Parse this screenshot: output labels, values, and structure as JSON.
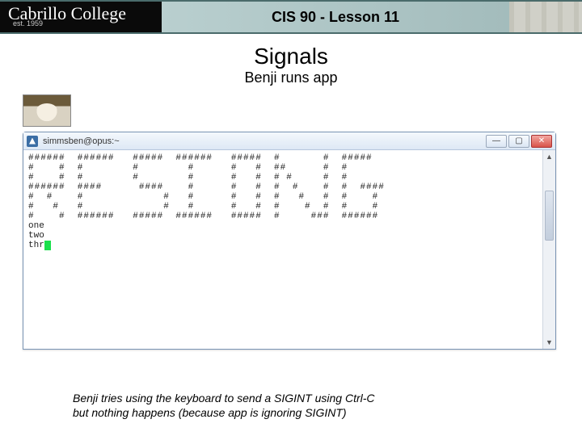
{
  "header": {
    "logo_name": "Cabrillo College",
    "logo_est": "est. 1959",
    "course_title": "CIS 90 - Lesson 11"
  },
  "slide": {
    "heading": "Signals",
    "subheading": "Benji runs app"
  },
  "window": {
    "title": "simmsben@opus:~",
    "btn_min": "—",
    "btn_max": "▢",
    "btn_close": "✕"
  },
  "terminal": {
    "ascii_art": "######  ######   #####  ######   #####  #       #  #####\n#    #  #        #        #      #   #  ##      #  #\n#    #  #        #        #      #   #  # #     #  #\n######  ####      ####    #      #   #  #  #    #  #  ####\n#  #    #             #   #      #   #  #   #   #  #    #\n#   #   #             #   #      #   #  #    #  #  #    #\n#    #  ######   #####  ######   #####  #     ###  ######",
    "lines": [
      "one",
      "two",
      "thr"
    ]
  },
  "caption": {
    "line1": "Benji tries using the keyboard to send a SIGINT using Ctrl-C",
    "line2": "but nothing happens (because app is ignoring SIGINT)"
  },
  "icons": {
    "scroll_up": "▲",
    "scroll_dn": "▼"
  }
}
